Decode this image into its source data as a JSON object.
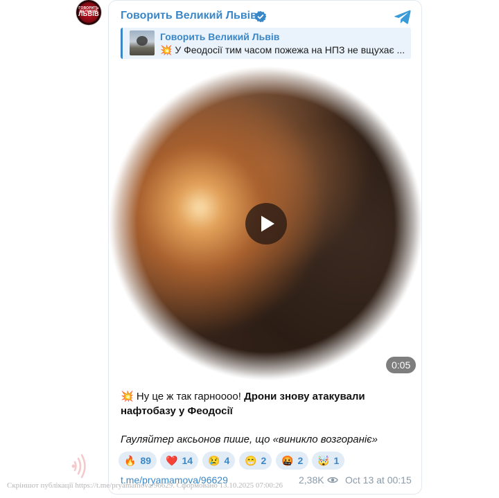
{
  "channel": {
    "name": "Говорить Великий Львів",
    "avatar_text_top": "ГОВОРИТЬ ВЕЛИКИЙ",
    "avatar_text_bottom": "ЛЬВІВ",
    "verified": true,
    "accent_color": "#3a87c8"
  },
  "reply": {
    "author": "Говорить Великий Львів",
    "text": "💥 У Феодосії тим часом пожежа на НПЗ не вщухає ..."
  },
  "video": {
    "duration": "0:05",
    "play_icon": "play-icon"
  },
  "message": {
    "emoji": "💥",
    "text_plain": " Ну це ж так гарноооо! ",
    "text_bold": "Дрони знову атакували нафтобазу у Феодосії",
    "text_italic": "Гауляйтер аксьонов пише, що «виникло возгораніє»"
  },
  "reactions": [
    {
      "emoji": "🔥",
      "count": "89"
    },
    {
      "emoji": "❤️",
      "count": "14"
    },
    {
      "emoji": "😢",
      "count": "4"
    },
    {
      "emoji": "😁",
      "count": "2"
    },
    {
      "emoji": "🤬",
      "count": "2"
    },
    {
      "emoji": "🤯",
      "count": "1"
    }
  ],
  "footer": {
    "link": "t.me/pryamamova/96629",
    "views": "2,38K",
    "time": "Oct 13 at 00:15"
  },
  "watermark": {
    "text": "Скріншот публікації https://t.me/pryamamova/96629. Сформовано 13.10.2025 07:00:26"
  }
}
